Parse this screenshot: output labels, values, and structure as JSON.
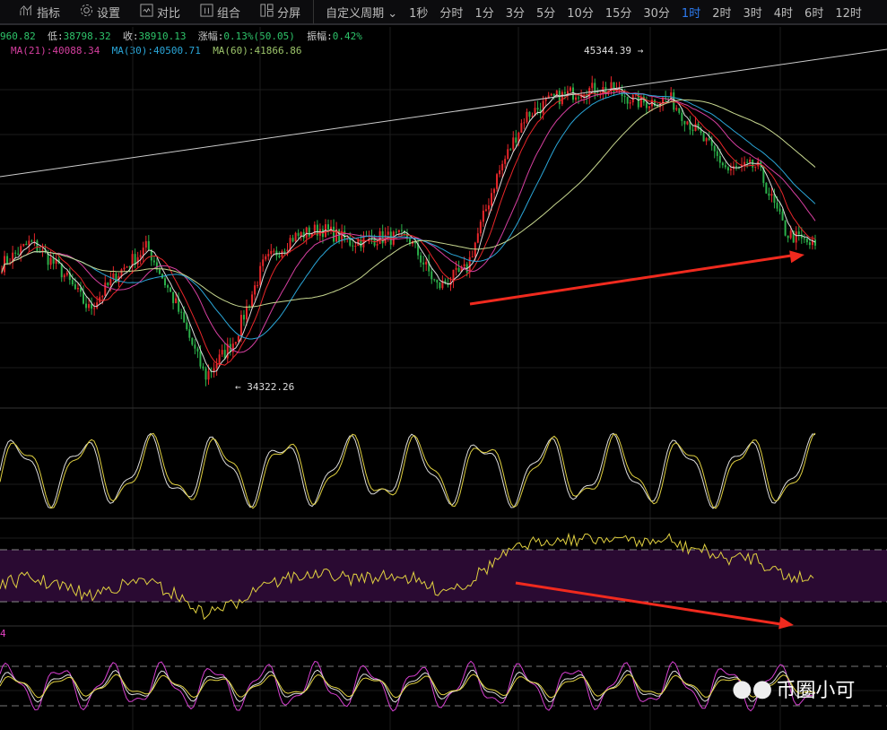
{
  "toolbar": {
    "items": [
      {
        "label": "指标",
        "icon": "chart-icon"
      },
      {
        "label": "设置",
        "icon": "gear-icon"
      },
      {
        "label": "对比",
        "icon": "compare-icon"
      },
      {
        "label": "组合",
        "icon": "layout-icon"
      },
      {
        "label": "分屏",
        "icon": "split-icon"
      }
    ],
    "period_dropdown": "自定义周期",
    "periods": [
      "1秒",
      "分时",
      "1分",
      "3分",
      "5分",
      "10分",
      "15分",
      "30分",
      "1时",
      "2时",
      "3时",
      "4时",
      "6时",
      "12时"
    ],
    "active_period": "1时"
  },
  "info": {
    "high_partial": "960.82",
    "low_label": "低:",
    "low": "38798.32",
    "close_label": "收:",
    "close": "38910.13",
    "change_label": "涨幅:",
    "change": "0.13%(50.05)",
    "amp_label": "振幅:",
    "amp": "0.42%"
  },
  "ma": [
    {
      "label": "MA(21):40088.34",
      "color": "#d63fa0"
    },
    {
      "label": "MA(30):40500.71",
      "color": "#2aa6d8"
    },
    {
      "label": "MA(60):41866.86",
      "color": "#9cc46a"
    }
  ],
  "annotations": {
    "high": "45344.39",
    "low": "34322.26"
  },
  "indicator_label": "4",
  "watermark": "币圈小可",
  "colors": {
    "up": "#e8262a",
    "down": "#2bb04a",
    "arrow": "#f02a1e"
  },
  "chart_data": {
    "type": "candlestick",
    "waypoints": [
      38349,
      39084,
      38202,
      36880,
      38055,
      38937,
      37026,
      34675,
      35851,
      38349,
      39231,
      39525,
      39084,
      39231,
      39231,
      37614,
      38202,
      41141,
      43199,
      43786,
      44080,
      44080,
      43639,
      43786,
      42611,
      41435,
      41582,
      39378,
      38937
    ]
  }
}
